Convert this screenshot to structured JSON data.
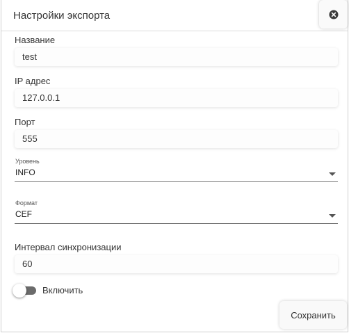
{
  "dialog": {
    "title": "Настройки экспорта",
    "close_icon": "close-circle-icon"
  },
  "fields": {
    "name": {
      "label": "Название",
      "value": "test"
    },
    "ip": {
      "label": "IP адрес",
      "value": "127.0.0.1"
    },
    "port": {
      "label": "Порт",
      "value": "555"
    },
    "level": {
      "label": "Уровень",
      "value": "INFO"
    },
    "format": {
      "label": "Формат",
      "value": "CEF"
    },
    "sync_interval": {
      "label": "Интервал синхронизации",
      "value": "60"
    }
  },
  "toggle": {
    "label": "Включить",
    "enabled": false
  },
  "actions": {
    "save_label": "Сохранить"
  },
  "colors": {
    "text": "#333333",
    "border": "#cfcfcf",
    "toggle_track": "#6b6b6b"
  }
}
